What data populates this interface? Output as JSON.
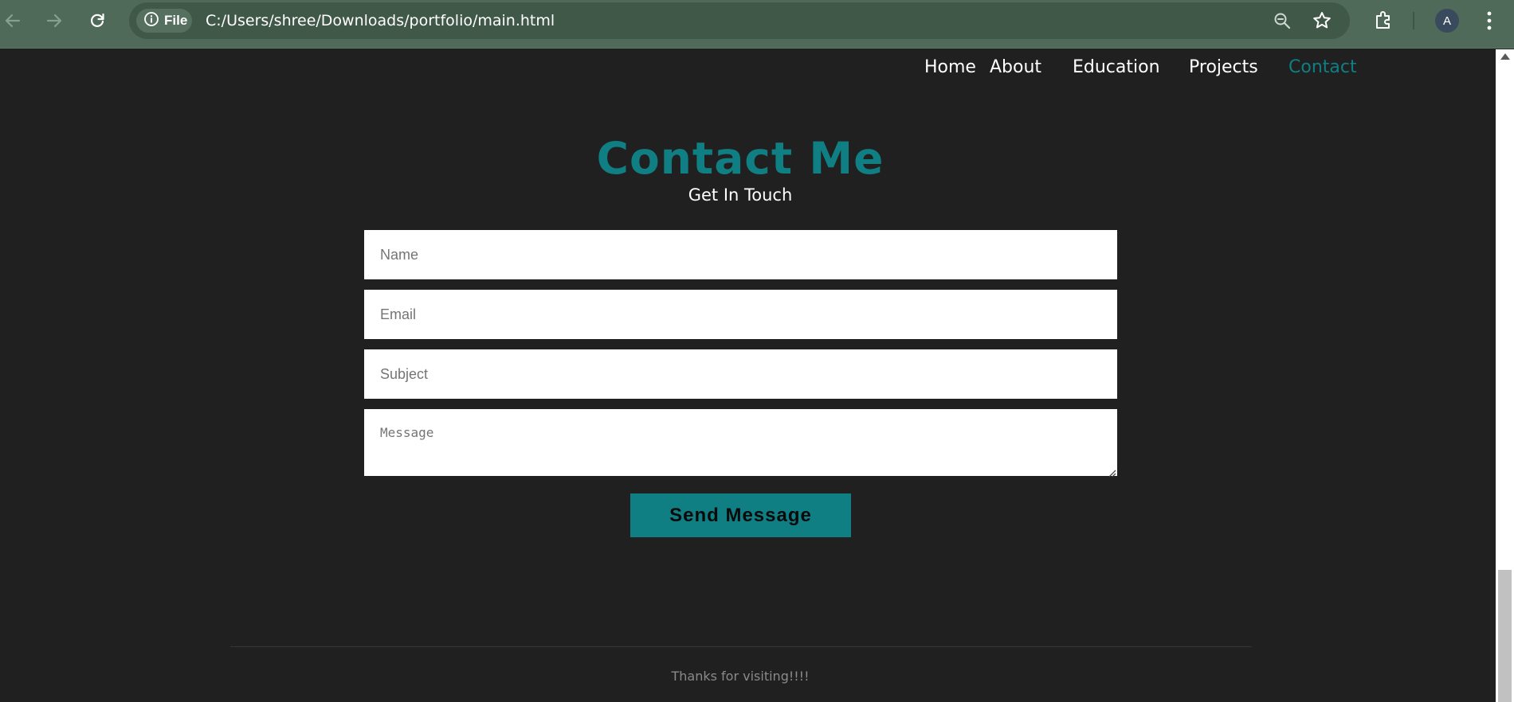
{
  "browser": {
    "site_info_label": "File",
    "url": "C:/Users/shree/Downloads/portfolio/main.html",
    "profile_initial": "A",
    "icons": [
      "back-arrow-icon",
      "forward-arrow-icon",
      "reload-icon",
      "info-icon",
      "zoom-icon",
      "star-icon",
      "extensions-icon",
      "menu-dots-icon"
    ]
  },
  "nav": {
    "items": [
      {
        "label": "Home",
        "active": false
      },
      {
        "label": "About",
        "active": false
      },
      {
        "label": "Education",
        "active": false
      },
      {
        "label": "Projects",
        "active": false
      },
      {
        "label": "Contact",
        "active": true
      }
    ]
  },
  "contact": {
    "title": "Contact Me",
    "subtitle": "Get In Touch",
    "fields": {
      "name": {
        "placeholder": "Name",
        "value": ""
      },
      "email": {
        "placeholder": "Email",
        "value": ""
      },
      "subject": {
        "placeholder": "Subject",
        "value": ""
      },
      "message": {
        "placeholder": "Message",
        "value": ""
      }
    },
    "submit_label": "Send Message"
  },
  "footer": {
    "text": "Thanks for visiting!!!!"
  },
  "colors": {
    "accent": "#0f7f84",
    "page_background": "#202020",
    "chrome_background": "#4f6a58"
  }
}
